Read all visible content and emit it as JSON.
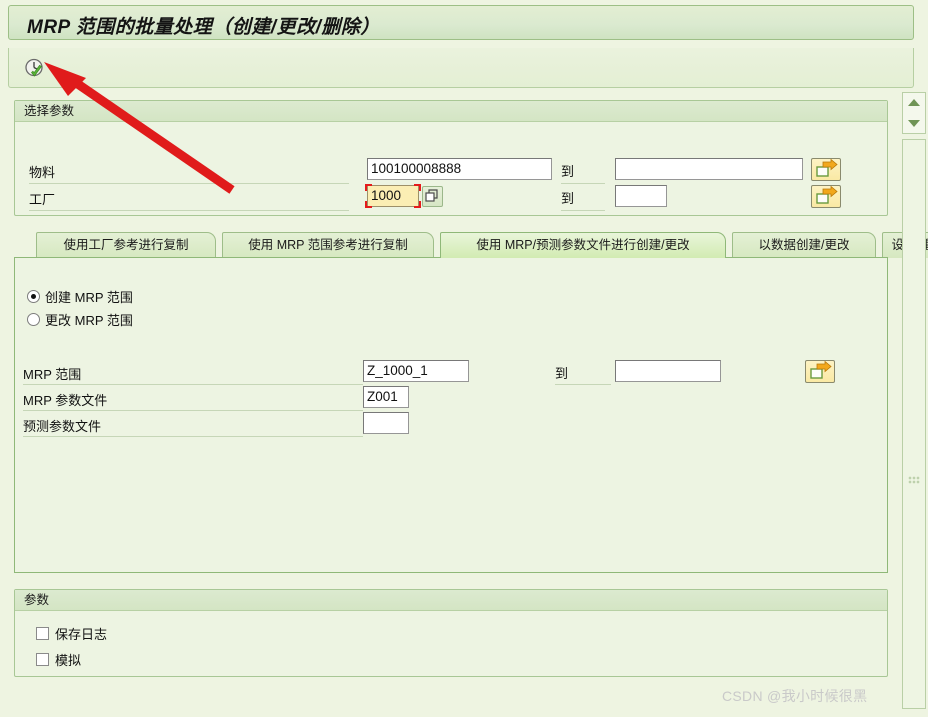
{
  "window": {
    "title": "MRP 范围的批量处理（创建/更改/删除）"
  },
  "toolbar": {
    "execute_label": "执行",
    "execute_icon": "clock-check-icon"
  },
  "selection_group": {
    "header": "选择参数",
    "rows": [
      {
        "label": "物料",
        "from_value": "100100008888",
        "to_label": "到",
        "to_value": "",
        "multi_select_icon": "multi-selection-arrow-icon"
      },
      {
        "label": "工厂",
        "from_value": "1000",
        "to_label": "到",
        "to_value": "",
        "multi_select_icon": "multi-selection-arrow-icon",
        "search_help_icon": "search-help-icon",
        "focused": true
      }
    ]
  },
  "tabs": [
    {
      "label": "使用工厂参考进行复制",
      "active": false
    },
    {
      "label": "使用 MRP 范围参考进行复制",
      "active": false
    },
    {
      "label": "使用 MRP/预测参数文件进行创建/更改",
      "active": true
    },
    {
      "label": "以数据创建/更改",
      "active": false
    },
    {
      "label": "设置/重",
      "active": false
    }
  ],
  "tab_content": {
    "radios": [
      {
        "label": "创建 MRP 范围",
        "selected": true
      },
      {
        "label": "更改 MRP 范围",
        "selected": false
      }
    ],
    "fields": [
      {
        "label": "MRP 范围",
        "value": "Z_1000_1",
        "to_label": "到",
        "to_value": "",
        "multi_select_icon": "multi-selection-arrow-icon"
      },
      {
        "label": "MRP 参数文件",
        "value": "Z001"
      },
      {
        "label": "预测参数文件",
        "value": ""
      }
    ]
  },
  "parameters_group": {
    "header": "参数",
    "checkboxes": [
      {
        "label": "保存日志",
        "checked": false
      },
      {
        "label": "模拟",
        "checked": false
      }
    ]
  },
  "scroll": {
    "up_icon": "scroll-up-icon",
    "down_icon": "scroll-down-icon"
  },
  "annotation": {
    "type": "red-arrow",
    "color": "#e01b1b",
    "points_to": "execute-button"
  },
  "watermark": {
    "text": "CSDN @我小时候很黑"
  },
  "colors": {
    "background": "#eef4e1",
    "group_border": "#a8c795",
    "header_gradient_top": "#dcead0",
    "focus_red": "#e51b1b",
    "focus_field_yellow": "#fbeeb4",
    "tab_active": "#d2ebb2"
  }
}
